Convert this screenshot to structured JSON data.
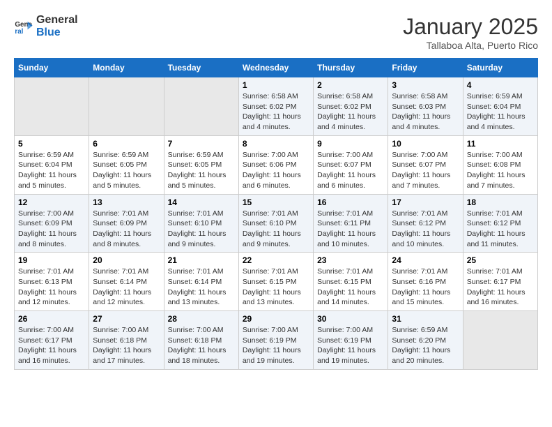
{
  "header": {
    "logo_line1": "General",
    "logo_line2": "Blue",
    "month": "January 2025",
    "location": "Tallaboa Alta, Puerto Rico"
  },
  "days_of_week": [
    "Sunday",
    "Monday",
    "Tuesday",
    "Wednesday",
    "Thursday",
    "Friday",
    "Saturday"
  ],
  "weeks": [
    [
      {
        "day": "",
        "info": ""
      },
      {
        "day": "",
        "info": ""
      },
      {
        "day": "",
        "info": ""
      },
      {
        "day": "1",
        "info": "Sunrise: 6:58 AM\nSunset: 6:02 PM\nDaylight: 11 hours and 4 minutes."
      },
      {
        "day": "2",
        "info": "Sunrise: 6:58 AM\nSunset: 6:02 PM\nDaylight: 11 hours and 4 minutes."
      },
      {
        "day": "3",
        "info": "Sunrise: 6:58 AM\nSunset: 6:03 PM\nDaylight: 11 hours and 4 minutes."
      },
      {
        "day": "4",
        "info": "Sunrise: 6:59 AM\nSunset: 6:04 PM\nDaylight: 11 hours and 4 minutes."
      }
    ],
    [
      {
        "day": "5",
        "info": "Sunrise: 6:59 AM\nSunset: 6:04 PM\nDaylight: 11 hours and 5 minutes."
      },
      {
        "day": "6",
        "info": "Sunrise: 6:59 AM\nSunset: 6:05 PM\nDaylight: 11 hours and 5 minutes."
      },
      {
        "day": "7",
        "info": "Sunrise: 6:59 AM\nSunset: 6:05 PM\nDaylight: 11 hours and 5 minutes."
      },
      {
        "day": "8",
        "info": "Sunrise: 7:00 AM\nSunset: 6:06 PM\nDaylight: 11 hours and 6 minutes."
      },
      {
        "day": "9",
        "info": "Sunrise: 7:00 AM\nSunset: 6:07 PM\nDaylight: 11 hours and 6 minutes."
      },
      {
        "day": "10",
        "info": "Sunrise: 7:00 AM\nSunset: 6:07 PM\nDaylight: 11 hours and 7 minutes."
      },
      {
        "day": "11",
        "info": "Sunrise: 7:00 AM\nSunset: 6:08 PM\nDaylight: 11 hours and 7 minutes."
      }
    ],
    [
      {
        "day": "12",
        "info": "Sunrise: 7:00 AM\nSunset: 6:09 PM\nDaylight: 11 hours and 8 minutes."
      },
      {
        "day": "13",
        "info": "Sunrise: 7:01 AM\nSunset: 6:09 PM\nDaylight: 11 hours and 8 minutes."
      },
      {
        "day": "14",
        "info": "Sunrise: 7:01 AM\nSunset: 6:10 PM\nDaylight: 11 hours and 9 minutes."
      },
      {
        "day": "15",
        "info": "Sunrise: 7:01 AM\nSunset: 6:10 PM\nDaylight: 11 hours and 9 minutes."
      },
      {
        "day": "16",
        "info": "Sunrise: 7:01 AM\nSunset: 6:11 PM\nDaylight: 11 hours and 10 minutes."
      },
      {
        "day": "17",
        "info": "Sunrise: 7:01 AM\nSunset: 6:12 PM\nDaylight: 11 hours and 10 minutes."
      },
      {
        "day": "18",
        "info": "Sunrise: 7:01 AM\nSunset: 6:12 PM\nDaylight: 11 hours and 11 minutes."
      }
    ],
    [
      {
        "day": "19",
        "info": "Sunrise: 7:01 AM\nSunset: 6:13 PM\nDaylight: 11 hours and 12 minutes."
      },
      {
        "day": "20",
        "info": "Sunrise: 7:01 AM\nSunset: 6:14 PM\nDaylight: 11 hours and 12 minutes."
      },
      {
        "day": "21",
        "info": "Sunrise: 7:01 AM\nSunset: 6:14 PM\nDaylight: 11 hours and 13 minutes."
      },
      {
        "day": "22",
        "info": "Sunrise: 7:01 AM\nSunset: 6:15 PM\nDaylight: 11 hours and 13 minutes."
      },
      {
        "day": "23",
        "info": "Sunrise: 7:01 AM\nSunset: 6:15 PM\nDaylight: 11 hours and 14 minutes."
      },
      {
        "day": "24",
        "info": "Sunrise: 7:01 AM\nSunset: 6:16 PM\nDaylight: 11 hours and 15 minutes."
      },
      {
        "day": "25",
        "info": "Sunrise: 7:01 AM\nSunset: 6:17 PM\nDaylight: 11 hours and 16 minutes."
      }
    ],
    [
      {
        "day": "26",
        "info": "Sunrise: 7:00 AM\nSunset: 6:17 PM\nDaylight: 11 hours and 16 minutes."
      },
      {
        "day": "27",
        "info": "Sunrise: 7:00 AM\nSunset: 6:18 PM\nDaylight: 11 hours and 17 minutes."
      },
      {
        "day": "28",
        "info": "Sunrise: 7:00 AM\nSunset: 6:18 PM\nDaylight: 11 hours and 18 minutes."
      },
      {
        "day": "29",
        "info": "Sunrise: 7:00 AM\nSunset: 6:19 PM\nDaylight: 11 hours and 19 minutes."
      },
      {
        "day": "30",
        "info": "Sunrise: 7:00 AM\nSunset: 6:19 PM\nDaylight: 11 hours and 19 minutes."
      },
      {
        "day": "31",
        "info": "Sunrise: 6:59 AM\nSunset: 6:20 PM\nDaylight: 11 hours and 20 minutes."
      },
      {
        "day": "",
        "info": ""
      }
    ]
  ]
}
